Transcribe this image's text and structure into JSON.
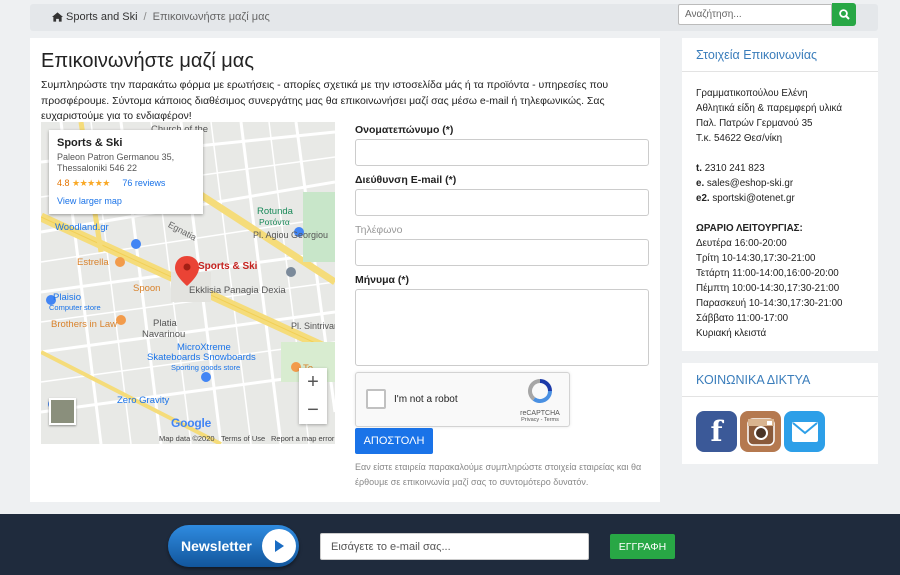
{
  "breadcrumb": {
    "home": "Sports and Ski",
    "current": "Επικοινωνήστε μαζί μας"
  },
  "search": {
    "placeholder": "Αναζήτηση..."
  },
  "main": {
    "title": "Επικοινωνήστε μαζί μας",
    "intro": "Συμπληρώστε την παρακάτω φόρμα με ερωτήσεις - απορίες σχετικά με την ιστοσελίδα μάς ή τα προϊόντα - υπηρεσίες που προσφέρουμε. Σύντομα κάποιος διαθέσιμος συνεργάτης μας θα επικοινωνήσει μαζί σας μέσω e-mail ή τηλεφωνικώς. Σας ευχαριστούμε για το ενδιαφέρον!"
  },
  "map": {
    "card_name": "Sports & Ski",
    "card_address_1": "Paleon Patron Germanou 35,",
    "card_address_2": "Thessaloniki 546 22",
    "rating": "4.8",
    "stars": "★★★★★",
    "reviews": "76 reviews",
    "larger_map": "View larger map",
    "pin_label": "Sports & Ski",
    "labels": {
      "church": "Church of the",
      "woodland": "Woodland.gr",
      "egnatia": "Egnatia",
      "rotunda": "Rotunda",
      "rotunda_gr": "Ροτόντα",
      "agiou": "Pl. Agiou Georgiou",
      "estrella": "Estrella",
      "spoon": "Spoon",
      "ekklisia": "Ekklisia Panagia Dexia",
      "plaisio": "Plaisio",
      "plaisio_sub": "Computer store",
      "brothers": "Brothers in Law",
      "platia": "Platia",
      "navarinou": "Navarinou",
      "sintrivani": "Pl. Sintrivan",
      "micro1": "MicroXtreme",
      "micro2": "Skateboards Snowboards",
      "micro_sub": "Sporting goods store",
      "zero": "Zero Gravity",
      "to": "Το"
    },
    "google": "Google",
    "footer": {
      "data": "Map data ©2020",
      "terms": "Terms of Use",
      "report": "Report a map error"
    }
  },
  "form": {
    "name_label": "Ονοματεπώνυμο (*)",
    "email_label": "Διεύθυνση E-mail (*)",
    "phone_label": "Τηλέφωνο",
    "message_label": "Μήνυμα (*)",
    "captcha_text": "I'm not a robot",
    "captcha_brand": "reCAPTCHA",
    "captcha_links": "Privacy - Terms",
    "submit": "ΑΠΟΣΤΟΛΗ",
    "note": "Εαν είστε εταιρεία παρακαλούμε συμπληρώστε στοιχεία εταιρείας και θα έρθουμε σε επικοινωνία μαζί σας το συντομότερο δυνατόν."
  },
  "contact": {
    "title": "Στοιχεία Επικοινωνίας",
    "line1": "Γραμματικοπούλου Ελένη",
    "line2": "Αθλητικά είδη & παρεμφερή υλικά",
    "line3": "Παλ. Πατρών Γερμανού 35",
    "line4": "Τ.κ. 54622 Θεσ/νίκη",
    "phone_key": "t.",
    "phone": "2310 241 823",
    "email_key": "e.",
    "email": "sales@eshop-ski.gr",
    "email2_key": "e2.",
    "email2": "sportski@otenet.gr",
    "hours_title": "ΩΡΑΡΙΟ ΛΕΙΤΟΥΡΓΙΑΣ:",
    "hours": [
      "Δευτέρα 16:00-20:00",
      "Τρίτη 10-14:30,17:30-21:00",
      "Τετάρτη 11:00-14:00,16:00-20:00",
      "Πέμπτη 10:00-14:30,17:30-21:00",
      "Παρασκευή 10-14:30,17:30-21:00",
      "Σάββατο 11:00-17:00",
      "Κυριακή κλειστά"
    ]
  },
  "social": {
    "title": "ΚΟΙΝΩΝΙΚΑ ΔΙΚΤΥΑ",
    "facebook_letter": "f"
  },
  "footer": {
    "newsletter": "Newsletter",
    "email_placeholder": "Εισάγετε το e-mail σας...",
    "signup": "ΕΓΓΡΑΦΗ"
  },
  "colors": {
    "accent": "#1a73e8",
    "success": "#28a745",
    "sidebar_title": "#3a7dbb",
    "footer_bg": "#1f2b3d",
    "facebook": "#3b5998",
    "instagram": "#b5794f",
    "mail": "#2d9fe8"
  }
}
